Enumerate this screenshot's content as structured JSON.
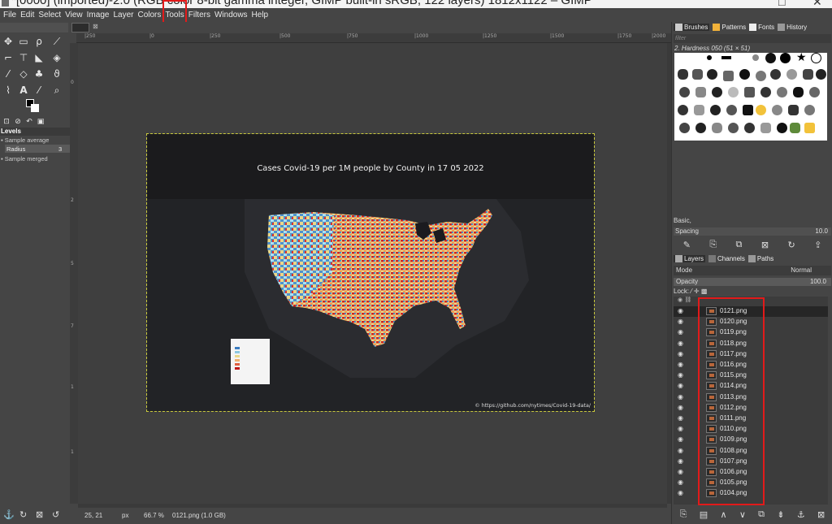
{
  "window": {
    "title": "*[0000] (imported)-2.0 (RGB color 8-bit gamma integer, GIMP built-in sRGB, 122 layers) 1812x1122 – GIMP"
  },
  "menu": [
    "File",
    "Edit",
    "Select",
    "View",
    "Image",
    "Layer",
    "Colors",
    "Tools",
    "Filters",
    "Windows",
    "Help"
  ],
  "tool_options": {
    "title": "Levels",
    "sample_average": "Sample average",
    "radius_label": "Radius",
    "radius_value": "3",
    "sample_merged": "Sample merged"
  },
  "ruler": {
    "top_ticks": [
      "|250",
      "|0",
      "|250",
      "|500",
      "|750",
      "|1000",
      "|1250",
      "|1500",
      "|1750",
      "|2000"
    ],
    "left_ticks": [
      "0",
      "2",
      "5",
      "7",
      "1",
      "1"
    ]
  },
  "image": {
    "map_title": "Cases Covid-19 per 1M people by County in 17 05 2022",
    "credit": "© https://github.com/nytimes/Covid-19-data/"
  },
  "statusbar": {
    "coords": "25, 21",
    "unit": "px",
    "zoom": "66.7 %",
    "info": "0121.png (1.0 GB)"
  },
  "brushes_dock": {
    "tabs": [
      "Brushes",
      "Patterns",
      "Fonts",
      "History"
    ],
    "filter_placeholder": "filter",
    "brush_name": "2. Hardness 050 (51 × 51)",
    "preset": "Basic,",
    "spacing_label": "Spacing",
    "spacing_value": "10.0"
  },
  "layers_dock": {
    "tabs": [
      "Layers",
      "Channels",
      "Paths"
    ],
    "mode_label": "Mode",
    "mode_value": "Normal",
    "opacity_label": "Opacity",
    "opacity_value": "100.0",
    "lock_label": "Lock:",
    "layers": [
      "0121.png",
      "0120.png",
      "0119.png",
      "0118.png",
      "0117.png",
      "0116.png",
      "0115.png",
      "0114.png",
      "0113.png",
      "0112.png",
      "0111.png",
      "0110.png",
      "0109.png",
      "0108.png",
      "0107.png",
      "0106.png",
      "0105.png",
      "0104.png"
    ]
  },
  "colors": {
    "highlight_red": "#e21a1a",
    "selection_outline": "#c8c83c"
  }
}
